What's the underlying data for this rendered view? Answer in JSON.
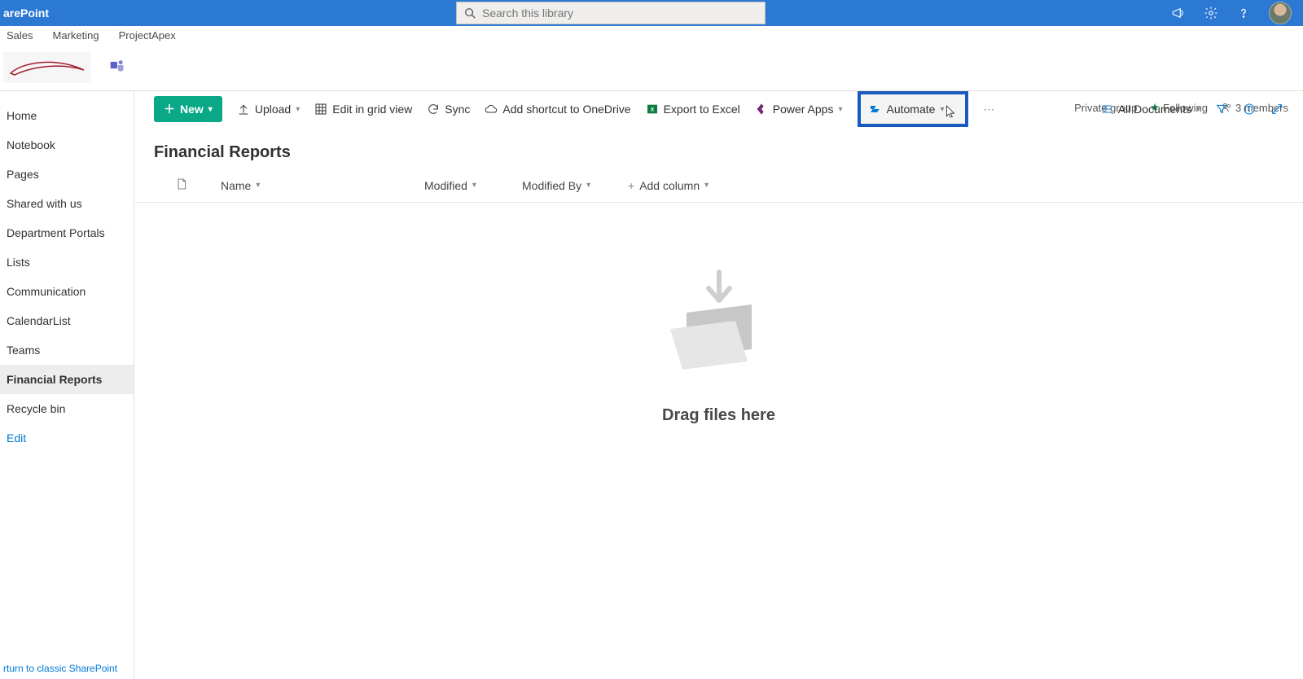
{
  "suite": {
    "app_name": "arePoint",
    "search_placeholder": "Search this library"
  },
  "hub_nav": [
    "Sales",
    "Marketing",
    "ProjectApex"
  ],
  "site_info": {
    "privacy": "Private group",
    "follow_label": "Following",
    "members_label": "3 members"
  },
  "sidenav": {
    "items": [
      {
        "label": "Home",
        "active": false
      },
      {
        "label": "Notebook",
        "active": false
      },
      {
        "label": "Pages",
        "active": false
      },
      {
        "label": "Shared with us",
        "active": false
      },
      {
        "label": "Department Portals",
        "active": false
      },
      {
        "label": "Lists",
        "active": false
      },
      {
        "label": "Communication",
        "active": false
      },
      {
        "label": "CalendarList",
        "active": false
      },
      {
        "label": "Teams",
        "active": false
      },
      {
        "label": "Financial Reports",
        "active": true
      },
      {
        "label": "Recycle bin",
        "active": false
      }
    ],
    "edit_label": "Edit",
    "classic_label": "rturn to classic SharePoint"
  },
  "commands": {
    "new": "New",
    "upload": "Upload",
    "gridview": "Edit in grid view",
    "sync": "Sync",
    "shortcut": "Add shortcut to OneDrive",
    "export": "Export to Excel",
    "powerapps": "Power Apps",
    "automate": "Automate",
    "alldocs": "All Documents"
  },
  "library": {
    "title": "Financial Reports",
    "columns": {
      "name": "Name",
      "modified": "Modified",
      "modified_by": "Modified By",
      "add_column": "Add column"
    },
    "empty_message": "Drag files here"
  }
}
